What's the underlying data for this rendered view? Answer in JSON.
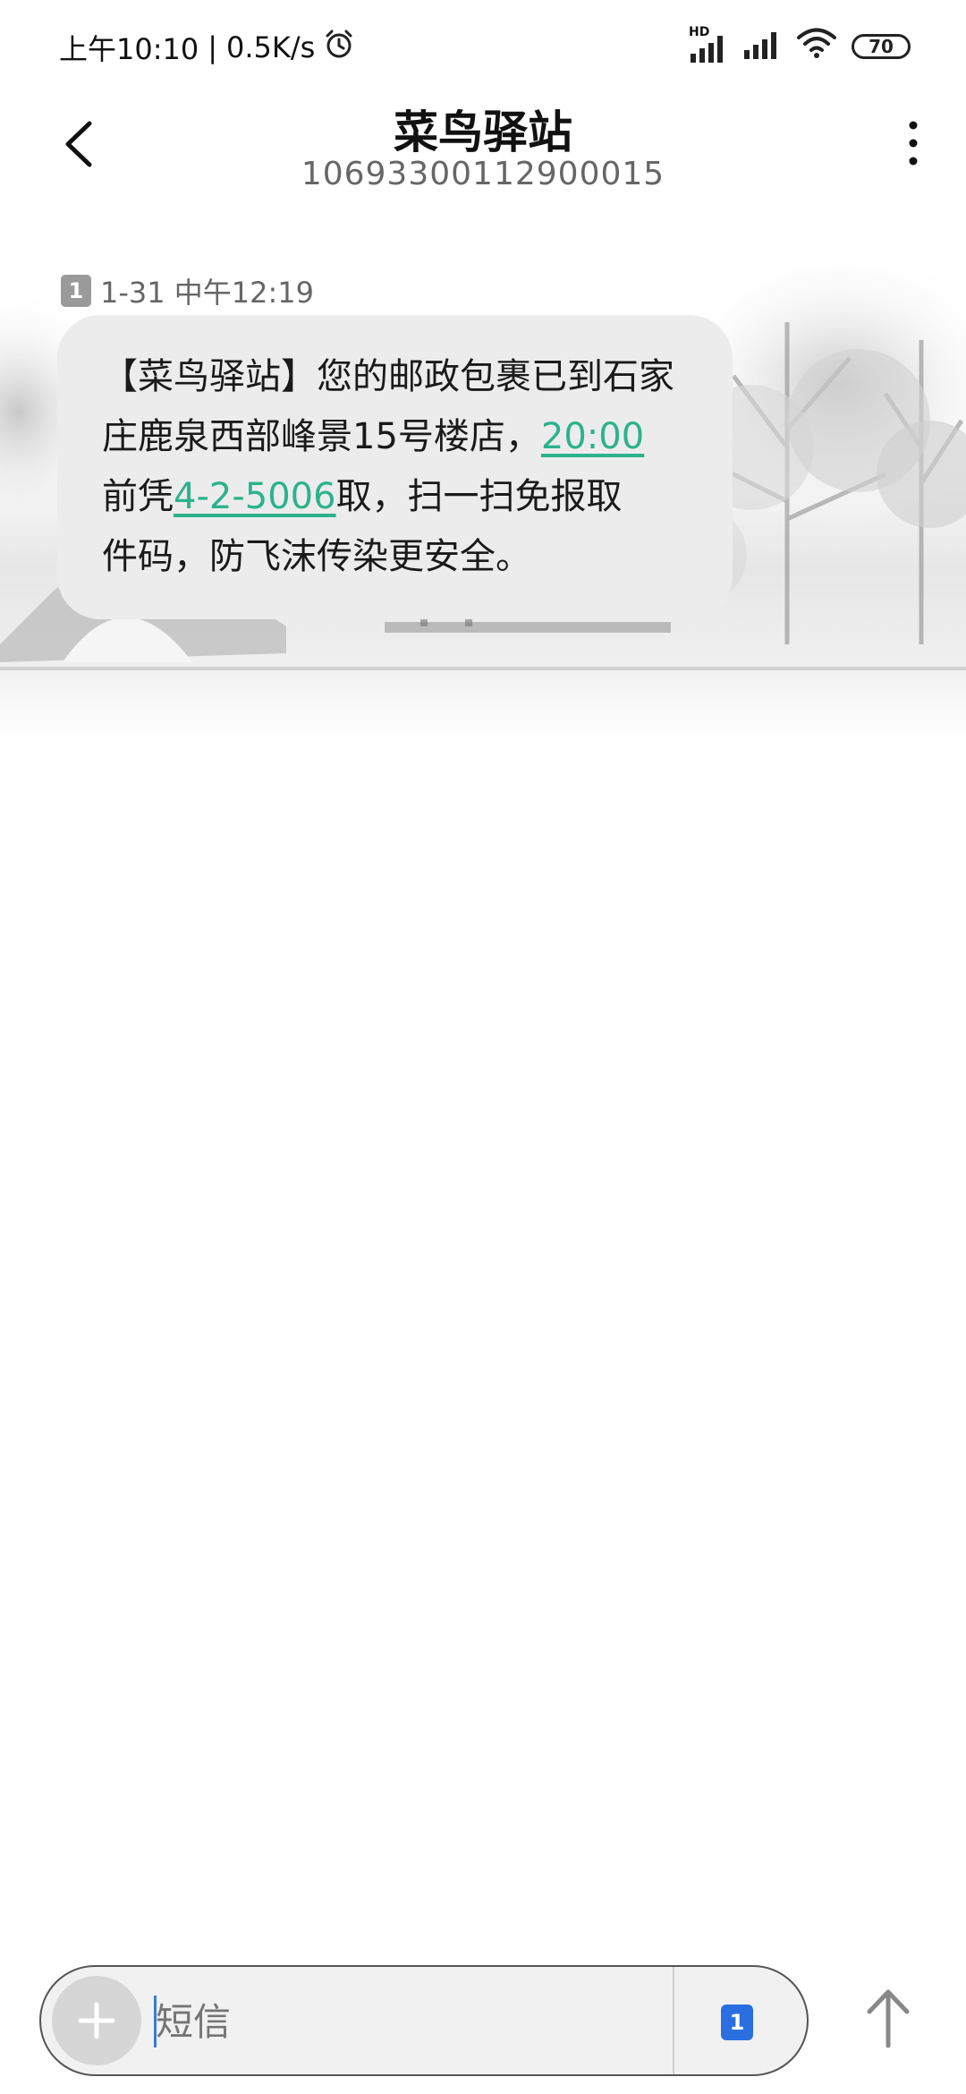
{
  "status_bar": {
    "time": "上午10:10",
    "separator": "|",
    "net_speed": "0.5K/s",
    "battery": "70",
    "hd_label": "HD"
  },
  "header": {
    "title": "菜鸟驿站",
    "number": "10693300112900015"
  },
  "message": {
    "sim": "1",
    "timestamp": "1-31 中午12:19",
    "line1": "【菜鸟驿站】您的邮政包裹已到石家",
    "line2_text": "庄鹿泉西部峰景15号楼店，",
    "line2_link": "20:00",
    "line3_pre": "前凭",
    "line3_link": "4-2-5006",
    "line3_post": "取，扫一扫免报取",
    "line4": "件码，防飞沫传染更安全。"
  },
  "composer": {
    "placeholder": "短信",
    "sim": "1"
  },
  "colors": {
    "link": "#2bb38a",
    "bubble": "#ececec",
    "sim_active": "#2a6fe0"
  },
  "icons": [
    "alarm-icon",
    "signal-icon",
    "wifi-icon",
    "back-arrow-icon",
    "more-vertical-icon",
    "plus-icon",
    "send-arrow-icon"
  ]
}
